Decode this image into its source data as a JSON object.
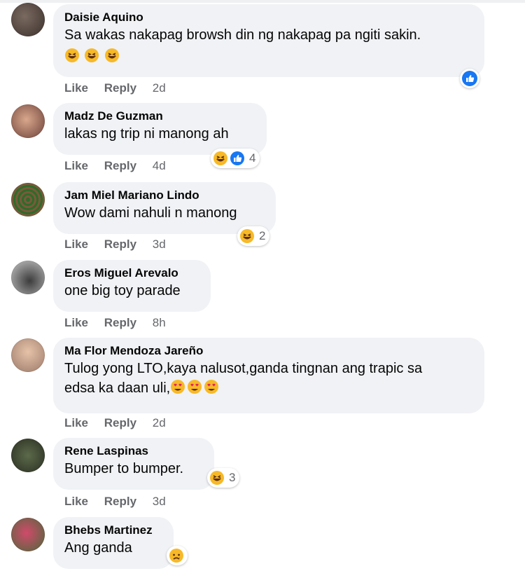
{
  "colors": {
    "like_blue": "#1877f2",
    "bubble_bg": "#f0f2f5",
    "meta_gray": "#65676b",
    "haha_yellow": "#f7b928"
  },
  "actions": {
    "like": "Like",
    "reply": "Reply"
  },
  "comments": [
    {
      "author": "Daisie Aquino",
      "text": "Sa wakas nakapag browsh din ng nakapag pa ngiti sakin.",
      "emoji_line": [
        "haha",
        "haha",
        "haha"
      ],
      "time": "2d",
      "reaction_icons": [
        "like"
      ],
      "reaction_count": ""
    },
    {
      "author": "Madz De Guzman",
      "text": "lakas ng trip ni manong ah",
      "time": "4d",
      "reaction_icons": [
        "haha",
        "like"
      ],
      "reaction_count": "4"
    },
    {
      "author": "Jam Miel Mariano Lindo",
      "text": "Wow dami nahuli n manong",
      "time": "3d",
      "reaction_icons": [
        "haha"
      ],
      "reaction_count": "2"
    },
    {
      "author": "Eros Miguel Arevalo",
      "text": "one big toy parade",
      "time": "8h"
    },
    {
      "author": "Ma Flor Mendoza Jareño",
      "text": "Tulog yong LTO,kaya nalusot,ganda tingnan ang trapic sa",
      "text_line2": "edsa ka daan uli,",
      "emoji_line": [
        "love-eyes",
        "love-eyes",
        "love-eyes"
      ],
      "time": "2d"
    },
    {
      "author": "Rene Laspinas",
      "text": "Bumper to bumper.",
      "time": "3d",
      "reaction_icons": [
        "haha"
      ],
      "reaction_count": "3"
    },
    {
      "author": "Bhebs Martinez",
      "text": "Ang ganda",
      "reaction_icons": [
        "sad"
      ]
    }
  ]
}
